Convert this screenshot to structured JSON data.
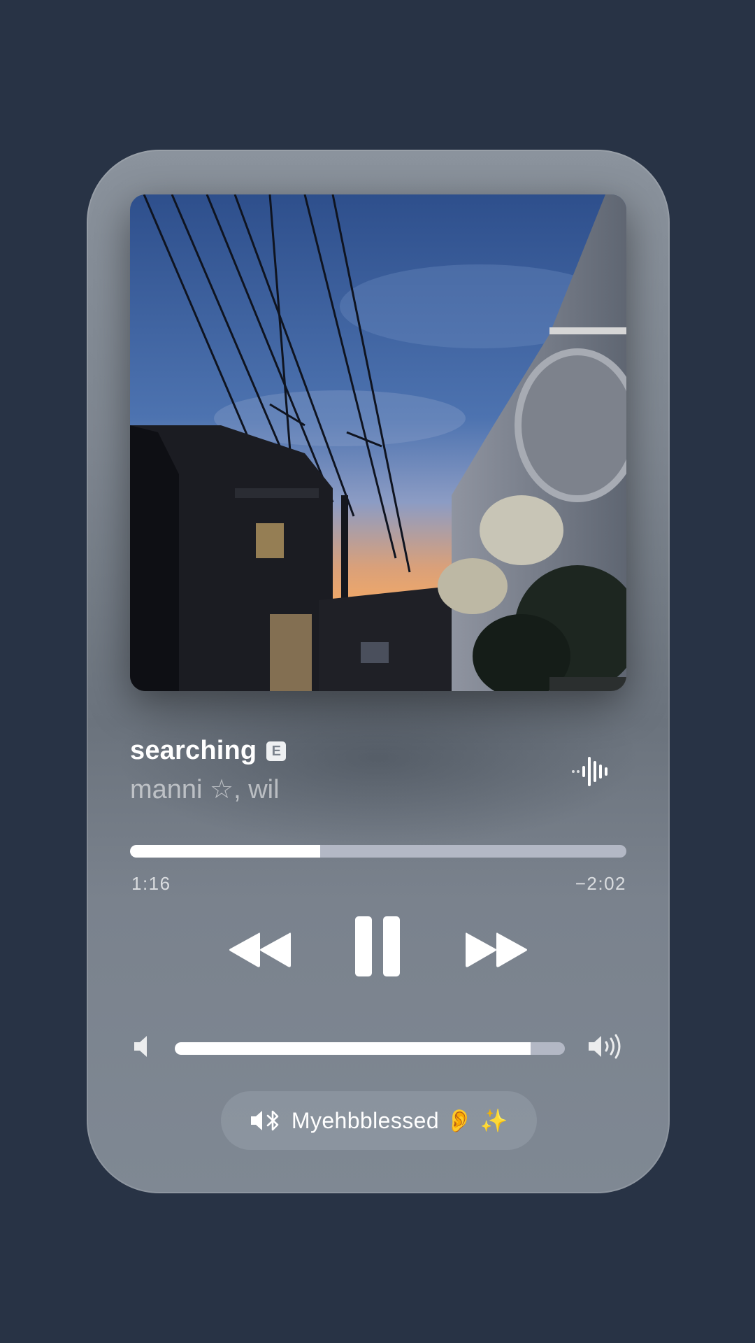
{
  "now_playing": {
    "title": "searching",
    "explicit_badge": "E",
    "artist": "manni ☆, wil",
    "progress_fraction": 0.383,
    "elapsed": "1:16",
    "remaining": "−2:02",
    "waveform_icon": "waveform-icon"
  },
  "transport": {
    "rewind_icon": "rewind-icon",
    "pause_icon": "pause-icon",
    "forward_icon": "fast-forward-icon"
  },
  "volume": {
    "level_fraction": 0.913,
    "low_icon": "speaker-low-icon",
    "high_icon": "speaker-high-icon"
  },
  "output_route": {
    "icons": [
      "speaker-icon",
      "bluetooth-icon"
    ],
    "device_name": "Myehbblessed 👂 ✨"
  },
  "colors": {
    "background": "#283345",
    "card_top": "#8b939d",
    "card_bottom": "#7f8893",
    "track_fill": "#ffffff",
    "track_rest": "#b3b8c5"
  }
}
